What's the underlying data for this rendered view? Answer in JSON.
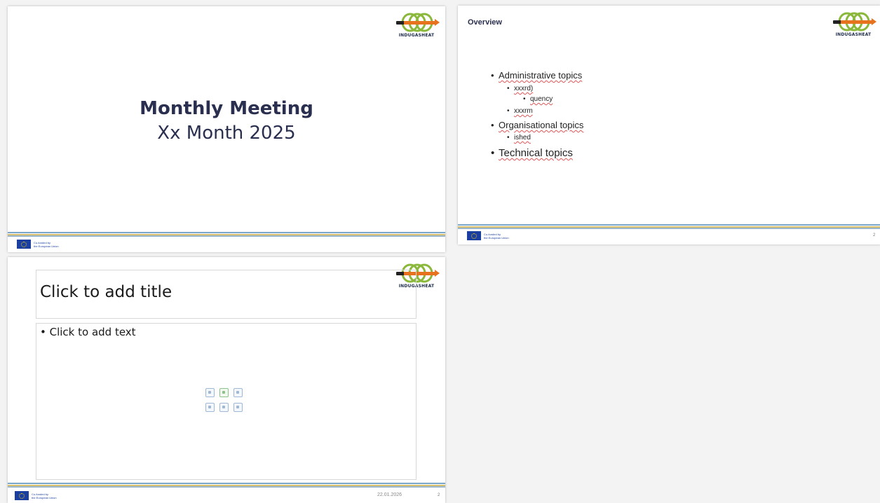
{
  "logo": {
    "text": "INDUGASHEAT"
  },
  "eu": {
    "line1": "Co-funded by",
    "line2": "the European Union"
  },
  "slide1": {
    "title": "Monthly Meeting",
    "subtitle": "Xx Month 2025"
  },
  "slide2": {
    "title": "Overview",
    "page": "2",
    "items": [
      {
        "text": "Administrative topics"
      },
      {
        "text": "xxxrd)"
      },
      {
        "text": "quency"
      },
      {
        "text": "xxxrm"
      },
      {
        "text": "Organisational topics"
      },
      {
        "text": "ished"
      },
      {
        "text": "Technical topics"
      }
    ]
  },
  "slide3": {
    "title_placeholder": "Click to add title",
    "body_placeholder": "• Click to add text",
    "date": "22.01.2026",
    "page": "2",
    "content_icons": [
      "table-icon",
      "chart-icon",
      "smartart-icon",
      "picture-icon",
      "online-picture-icon",
      "video-icon"
    ]
  },
  "colors": {
    "title_navy": "#2a2f4f",
    "logo_green": "#8ab83a",
    "logo_orange": "#e8731f",
    "eu_blue": "#1b3fa0"
  }
}
